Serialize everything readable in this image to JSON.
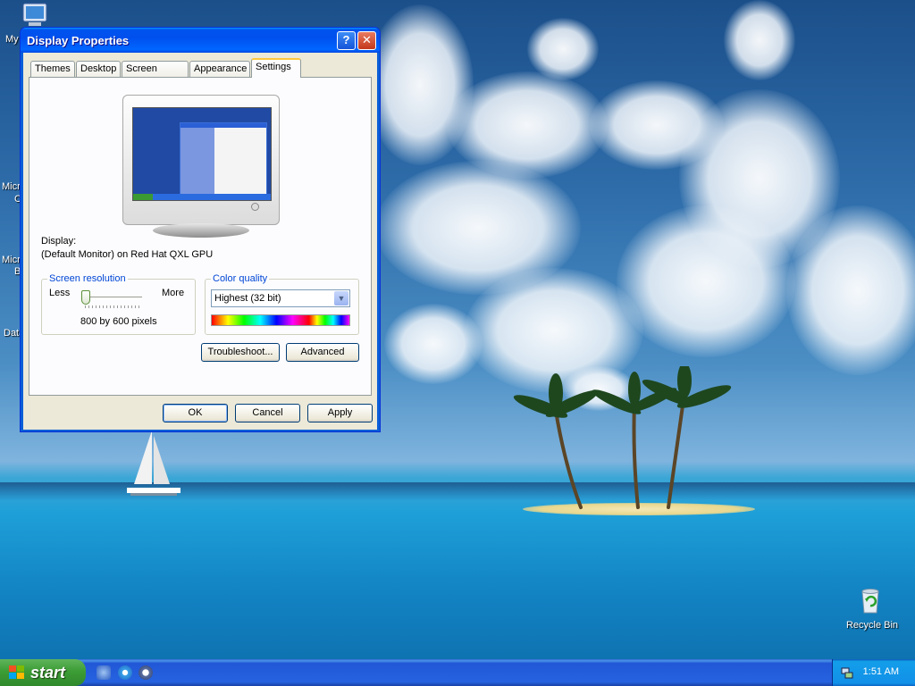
{
  "desktop": {
    "icons_left": [
      "My",
      "Micr",
      "C",
      "Micr",
      "B",
      "Data"
    ],
    "recycle_bin": "Recycle Bin"
  },
  "window": {
    "title": "Display Properties",
    "help_glyph": "?",
    "close_glyph": "✕",
    "tabs": [
      "Themes",
      "Desktop",
      "Screen Saver",
      "Appearance",
      "Settings"
    ],
    "active_tab": "Settings",
    "display_label": "Display:",
    "display_value": "(Default Monitor) on Red Hat QXL GPU",
    "resolution": {
      "title": "Screen resolution",
      "less": "Less",
      "more": "More",
      "value_text": "800 by 600 pixels",
      "slider_level": 0
    },
    "color": {
      "title": "Color quality",
      "selected": "Highest (32 bit)",
      "arrow": "▼"
    },
    "buttons": {
      "troubleshoot": "Troubleshoot...",
      "advanced": "Advanced",
      "ok": "OK",
      "cancel": "Cancel",
      "apply": "Apply"
    }
  },
  "taskbar": {
    "start_label": "start",
    "clock": "1:51 AM"
  },
  "colors": {
    "title_blue": "#0053ee",
    "group_title": "#0046d5",
    "start_green": "#3c9c35",
    "taskbar_blue": "#2663e0"
  }
}
